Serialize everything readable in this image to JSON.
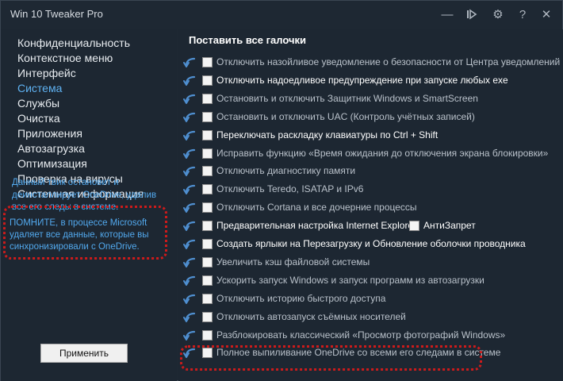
{
  "window": {
    "title": "Win 10 Tweaker Pro"
  },
  "titlebar_icons": [
    "minimize-icon",
    "play-icon",
    "gear-icon",
    "help-icon",
    "close-icon"
  ],
  "titlebar_glyphs": {
    "minimize": "—",
    "play": "⊳",
    "gear": "⚙",
    "help": "?",
    "close": "✕"
  },
  "sidebar": {
    "items": [
      {
        "label": "Конфиденциальность",
        "active": false
      },
      {
        "label": "Контекстное меню",
        "active": false
      },
      {
        "label": "Интерфейс",
        "active": false
      },
      {
        "label": "Система",
        "active": true
      },
      {
        "label": "Службы",
        "active": false
      },
      {
        "label": "Очистка",
        "active": false
      },
      {
        "label": "Приложения",
        "active": false
      },
      {
        "label": "Автозагрузка",
        "active": false
      },
      {
        "label": "Оптимизация",
        "active": false
      },
      {
        "label": "Проверка на вирусы",
        "active": false
      },
      {
        "label": "Системная информация",
        "active": false
      }
    ],
    "info_text": "Данный твик остановит и деинсталлирует OneDrive, удалив все его следы в системе.",
    "warning_text": "ПОМНИТЕ, в процессе Microsoft удаляет все данные, которые вы синхронизировали с OneDrive.",
    "apply_label": "Применить"
  },
  "main": {
    "check_all_label": "Поставить все галочки",
    "options": [
      {
        "label": "Отключить назойливое уведомление о безопасности от Центра уведомлений",
        "bright": false
      },
      {
        "label": "Отключить надоедливое предупреждение при запуске любых exe",
        "bright": true
      },
      {
        "label": "Остановить и отключить Защитник Windows и SmartScreen",
        "bright": false
      },
      {
        "label": "Остановить и отключить UAC (Контроль учётных записей)",
        "bright": false
      },
      {
        "label": "Переключать раскладку клавиатуры по Ctrl + Shift",
        "bright": true
      },
      {
        "label": "Исправить функцию «Время ожидания до отключения экрана блокировки»",
        "bright": false
      },
      {
        "label": "Отключить диагностику памяти",
        "bright": false
      },
      {
        "label": "Отключить Teredo, ISATAP и IPv6",
        "bright": false
      },
      {
        "label": "Отключить Cortana и все дочерние процессы",
        "bright": false
      },
      {
        "label": "Предварительная настройка Internet Explorer",
        "bright": true,
        "extra": "АнтиЗапрет"
      },
      {
        "label": "Создать ярлыки на Перезагрузку и Обновление оболочки проводника",
        "bright": true
      },
      {
        "label": "Увеличить кэш файловой системы",
        "bright": false
      },
      {
        "label": "Ускорить запуск Windows и запуск программ из автозагрузки",
        "bright": false
      },
      {
        "label": "Отключить историю быстрого доступа",
        "bright": false
      },
      {
        "label": "Отключить автозапуск съёмных носителей",
        "bright": false
      },
      {
        "label": "Разблокировать классический «Просмотр фотографий Windows»",
        "bright": false
      },
      {
        "label": "Полное выпиливание OneDrive со всеми его следами в системе",
        "bright": false
      }
    ]
  },
  "colors": {
    "accent": "#5fb2f2",
    "warning_outline": "#cc1b1b",
    "background": "#1d2732"
  }
}
